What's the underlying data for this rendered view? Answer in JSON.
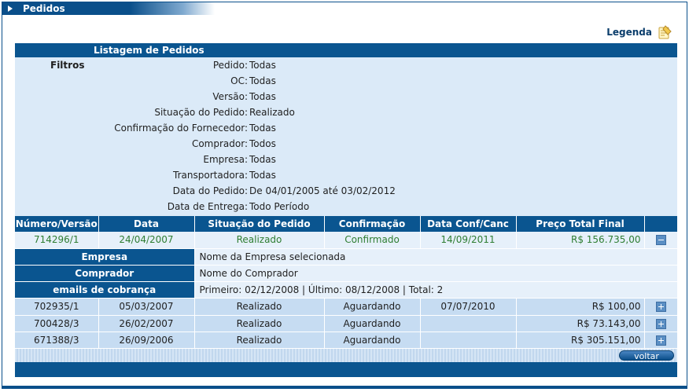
{
  "window": {
    "title": "Pedidos"
  },
  "legend": {
    "label": "Legenda",
    "icon": "legend-icon"
  },
  "listing": {
    "header": "Listagem de Pedidos",
    "filters_title": "Filtros",
    "filters": [
      {
        "key": "Pedido:",
        "value": "Todas"
      },
      {
        "key": "OC:",
        "value": "Todas"
      },
      {
        "key": "Versão:",
        "value": "Todas"
      },
      {
        "key": "Situação do Pedido:",
        "value": "Realizado"
      },
      {
        "key": "Confirmação do Fornecedor:",
        "value": "Todas"
      },
      {
        "key": "Comprador:",
        "value": "Todos"
      },
      {
        "key": "Empresa:",
        "value": "Todas"
      },
      {
        "key": "Transportadora:",
        "value": "Todas"
      },
      {
        "key": "Data do Pedido:",
        "value": "De 04/01/2005 até 03/02/2012"
      },
      {
        "key": "Data de Entrega:",
        "value": "Todo Período"
      }
    ]
  },
  "table": {
    "columns": [
      "Número/Versão",
      "Data",
      "Situação do Pedido",
      "Confirmação",
      "Data Conf/Canc",
      "Preço Total Final"
    ],
    "selected_row": [
      "714296/1",
      "24/04/2007",
      "Realizado",
      "Confirmado",
      "14/09/2011",
      "R$ 156.735,00"
    ],
    "detail": [
      {
        "key": "Empresa",
        "value": "Nome da Empresa selecionada"
      },
      {
        "key": "Comprador",
        "value": "Nome do Comprador"
      },
      {
        "key": "emails de cobrança",
        "value": "Primeiro: 02/12/2008 | Último: 08/12/2008 | Total: 2"
      }
    ],
    "rows": [
      [
        "702935/1",
        "05/03/2007",
        "Realizado",
        "Aguardando",
        "07/07/2010",
        "R$ 100,00"
      ],
      [
        "700428/3",
        "26/02/2007",
        "Realizado",
        "Aguardando",
        "",
        "R$ 73.143,00"
      ],
      [
        "671388/3",
        "26/09/2006",
        "Realizado",
        "Aguardando",
        "",
        "R$ 305.151,00"
      ]
    ]
  },
  "footer": {
    "voltar_label": "voltar"
  },
  "colors": {
    "primary": "#0a5590",
    "filters_bg": "#dbeaf8",
    "row_bg": "#c6dcf2",
    "selected_bg": "#e6f0fa",
    "selected_text": "#2e7d32"
  }
}
